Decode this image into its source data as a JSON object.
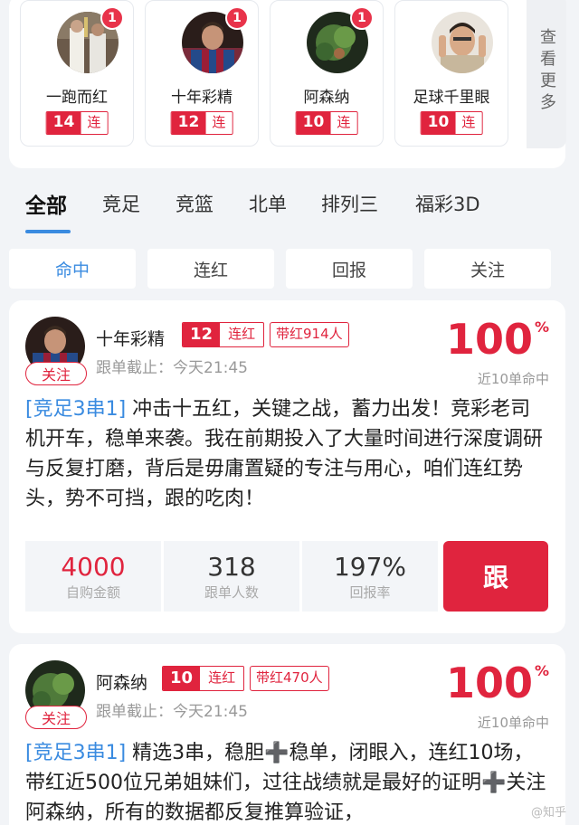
{
  "experts": [
    {
      "name": "一跑而红",
      "badge": "1",
      "streak": "14",
      "streak_label": "连红",
      "avatar": "avatar-photo"
    },
    {
      "name": "十年彩精",
      "badge": "1",
      "streak": "12",
      "streak_label": "连红",
      "avatar": "avatar-photo"
    },
    {
      "name": "阿森纳",
      "badge": "1",
      "streak": "10",
      "streak_label": "连红",
      "avatar": "avatar-photo"
    },
    {
      "name": "足球千里眼",
      "badge": "",
      "streak": "10",
      "streak_label": "连红",
      "avatar": "avatar-photo"
    }
  ],
  "more_label": "查看更多",
  "category_tabs": [
    "全部",
    "竞足",
    "竞篮",
    "北单",
    "排列三",
    "福彩3D"
  ],
  "sort_tabs": [
    "命中",
    "连红",
    "回报",
    "关注"
  ],
  "posts": [
    {
      "name": "十年彩精",
      "streak": "12",
      "streak_label": "连红",
      "carry": "带红914人",
      "follow": "关注",
      "deadline": "跟单截止：今天21:45",
      "rate": "100",
      "rate_unit": "%",
      "rate_label": "近10单命中",
      "tag": "[竞足3串1]",
      "text": " 冲击十五红，关键之战，蓄力出发！竞彩老司机开车，稳单来袭。我在前期投入了大量时间进行深度调研与反复打磨，背后是毋庸置疑的专注与用心，咱们连红势头，势不可挡，跟的吃肉！",
      "stats": [
        {
          "value": "4000",
          "label": "自购金额"
        },
        {
          "value": "318",
          "label": "跟单人数"
        },
        {
          "value": "197%",
          "label": "回报率"
        }
      ],
      "action": "跟"
    },
    {
      "name": "阿森纳",
      "streak": "10",
      "streak_label": "连红",
      "carry": "带红470人",
      "follow": "关注",
      "deadline": "跟单截止：今天21:45",
      "rate": "100",
      "rate_unit": "%",
      "rate_label": "近10单命中",
      "tag": "[竞足3串1]",
      "text": " 精选3串，稳胆➕稳单，闭眼入，连红10场，带红近500位兄弟姐妹们，过往战绩就是最好的证明➕关注阿森纳，所有的数据都反复推算验证，"
    }
  ],
  "watermark": "@知乎"
}
